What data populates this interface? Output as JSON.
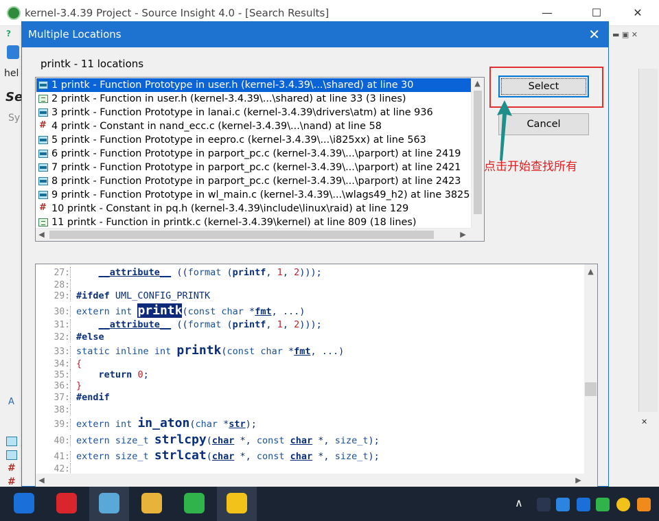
{
  "main_window": {
    "title": "kernel-3.4.39 Project - Source Insight 4.0 - [Search Results]",
    "minimize_glyph": "—",
    "maximize_glyph": "☐",
    "close_glyph": "✕",
    "side_fragments": {
      "help_fragment": "hel",
      "search_fragment": "Se",
      "sy_fragment": "Sy",
      "a_fragment": "A",
      "question_fragment": "?"
    }
  },
  "dialog": {
    "title": "Multiple Locations",
    "close_glyph": "✕",
    "heading": "printk - 11 locations",
    "buttons": {
      "select": "Select",
      "cancel": "Cancel"
    },
    "annotation": "点击开始查找所有",
    "annotation_color": "#e02020",
    "locations": [
      {
        "text": "1 printk - Function Prototype in user.h (kernel-3.4.39\\...\\shared) at line 30",
        "icon": "prototype-icon",
        "selected": true
      },
      {
        "text": "2 printk - Function in user.h (kernel-3.4.39\\...\\shared) at line 33 (3 lines)",
        "icon": "function-icon",
        "selected": false
      },
      {
        "text": "3 printk - Function Prototype in lanai.c (kernel-3.4.39\\drivers\\atm) at line 936",
        "icon": "prototype-icon",
        "selected": false
      },
      {
        "text": "4 printk - Constant in nand_ecc.c (kernel-3.4.39\\...\\nand) at line 58",
        "icon": "constant-icon",
        "selected": false
      },
      {
        "text": "5 printk - Function Prototype in eepro.c (kernel-3.4.39\\...\\i825xx) at line 563",
        "icon": "prototype-icon",
        "selected": false
      },
      {
        "text": "6 printk - Function Prototype in parport_pc.c (kernel-3.4.39\\...\\parport) at line 2419",
        "icon": "prototype-icon",
        "selected": false
      },
      {
        "text": "7 printk - Function Prototype in parport_pc.c (kernel-3.4.39\\...\\parport) at line 2421",
        "icon": "prototype-icon",
        "selected": false
      },
      {
        "text": "8 printk - Function Prototype in parport_pc.c (kernel-3.4.39\\...\\parport) at line 2423",
        "icon": "prototype-icon",
        "selected": false
      },
      {
        "text": "9 printk - Function Prototype in wl_main.c (kernel-3.4.39\\...\\wlags49_h2) at line 3825",
        "icon": "prototype-icon",
        "selected": false
      },
      {
        "text": "10 printk - Constant in pq.h (kernel-3.4.39\\include\\linux\\raid) at line 129",
        "icon": "constant-icon",
        "selected": false
      },
      {
        "text": "11 printk - Function in printk.c (kernel-3.4.39\\kernel) at line 809 (18 lines)",
        "icon": "function-icon",
        "selected": false
      }
    ]
  },
  "code_preview": {
    "lines": [
      {
        "num": "27:",
        "kind": "attr"
      },
      {
        "num": "28:",
        "kind": "blank"
      },
      {
        "num": "29:",
        "kind": "ifdef"
      },
      {
        "num": "30:",
        "kind": "decl_sel"
      },
      {
        "num": "31:",
        "kind": "attr"
      },
      {
        "num": "32:",
        "kind": "else"
      },
      {
        "num": "33:",
        "kind": "static"
      },
      {
        "num": "34:",
        "kind": "open"
      },
      {
        "num": "35:",
        "kind": "return"
      },
      {
        "num": "36:",
        "kind": "close"
      },
      {
        "num": "37:",
        "kind": "endif"
      },
      {
        "num": "38:",
        "kind": "blank"
      },
      {
        "num": "39:",
        "kind": "in_aton"
      },
      {
        "num": "40:",
        "kind": "strlcpy"
      },
      {
        "num": "41:",
        "kind": "strlcat"
      },
      {
        "num": "42:",
        "kind": "blank"
      }
    ],
    "tokens": {
      "attribute": "__attribute__",
      "format": "format",
      "printf": "printf",
      "one": "1",
      "two": "2",
      "ifdef": "#ifdef",
      "config": "UML_CONFIG_PRINTK",
      "extern": "extern",
      "int": "int",
      "printk": "printk",
      "const": "const",
      "char": "char",
      "fmt": "fmt",
      "ellipsis": "...",
      "else": "#else",
      "static": "static",
      "inline": "inline",
      "return": "return",
      "zero": "0",
      "endif": "#endif",
      "in_aton": "in_aton",
      "str": "str",
      "size_t": "size_t",
      "strlcpy": "strlcpy",
      "strlcat": "strlcat",
      "open_brace": "{",
      "close_brace": "}"
    }
  },
  "colors": {
    "dialog_titlebar": "#1e73d0",
    "selection": "#0a64d8",
    "highlight_box": "#e23030",
    "taskbar": "#1b2433"
  },
  "taskbar": {
    "apps": [
      {
        "name": "thunder-icon",
        "color": "#1a6fd8"
      },
      {
        "name": "netease-music-icon",
        "color": "#d9262c"
      },
      {
        "name": "source-insight-icon",
        "color": "#5aa8d8"
      },
      {
        "name": "file-explorer-icon",
        "color": "#e8b33a"
      },
      {
        "name": "wechat-icon",
        "color": "#2fb34a"
      },
      {
        "name": "chart-app-icon",
        "color": "#f2c21a"
      }
    ]
  }
}
